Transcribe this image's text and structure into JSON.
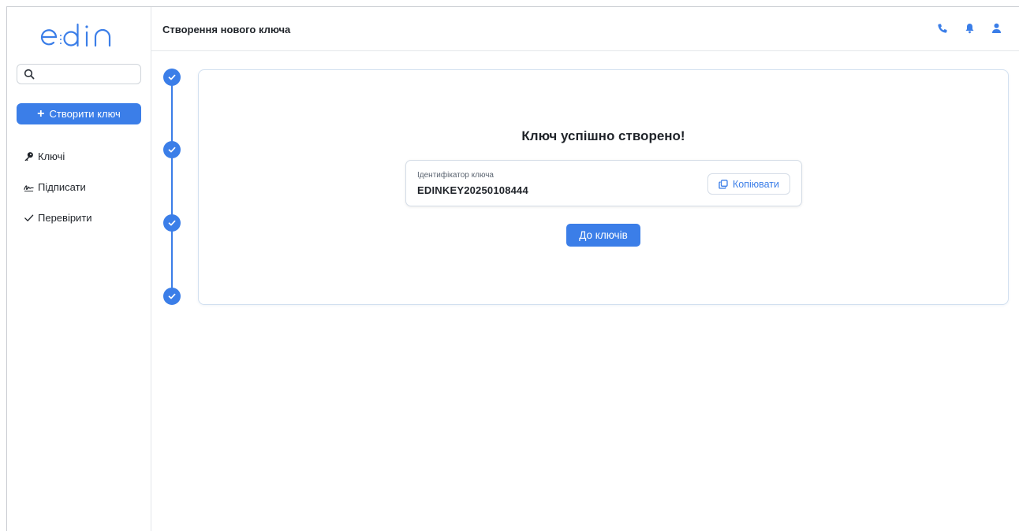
{
  "brand": {
    "logo_text": "edin",
    "accent": "#3b7ee8"
  },
  "sidebar": {
    "search": {
      "placeholder": "",
      "value": ""
    },
    "create_button": {
      "icon": "plus-icon",
      "label": "Створити ключ"
    },
    "items": [
      {
        "icon": "key-icon",
        "label": "Ключі"
      },
      {
        "icon": "signature-icon",
        "label": "Підписати"
      },
      {
        "icon": "check-icon",
        "label": "Перевірити"
      }
    ]
  },
  "header": {
    "title": "Створення нового ключа",
    "icons": [
      "phone-icon",
      "bell-icon",
      "user-icon"
    ]
  },
  "stepper": {
    "steps_total": 4,
    "steps_completed": 4
  },
  "main": {
    "heading": "Ключ успішно створено!",
    "key_label": "Ідентифікатор ключа",
    "key_value": "EDINKEY20250108444",
    "copy_label": "Копіювати",
    "to_keys_label": "До ключів"
  }
}
